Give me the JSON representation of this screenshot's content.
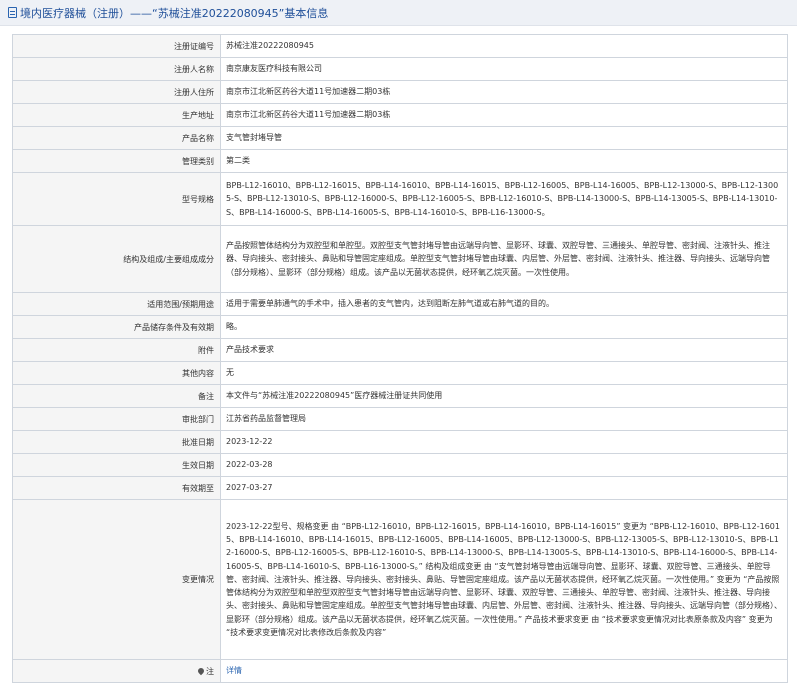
{
  "header": {
    "title": "境内医疗器械（注册）——“苏械注准20222080945”基本信息"
  },
  "rows": [
    {
      "label": "注册证编号",
      "value": "苏械注准20222080945"
    },
    {
      "label": "注册人名称",
      "value": "南京康友医疗科技有限公司"
    },
    {
      "label": "注册人住所",
      "value": "南京市江北新区药谷大道11号加速器二期03栋"
    },
    {
      "label": "生产地址",
      "value": "南京市江北新区药谷大道11号加速器二期03栋"
    },
    {
      "label": "产品名称",
      "value": "支气管封堵导管"
    },
    {
      "label": "管理类别",
      "value": "第二类"
    },
    {
      "label": "型号规格",
      "value": "BPB-L12-16010、BPB-L12-16015、BPB-L14-16010、BPB-L14-16015、BPB-L12-16005、BPB-L14-16005、BPB-L12-13000-S、BPB-L12-13005-S、BPB-L12-13010-S、BPB-L12-16000-S、BPB-L12-16005-S、BPB-L12-16010-S、BPB-L14-13000-S、BPB-L14-13005-S、BPB-L14-13010-S、BPB-L14-16000-S、BPB-L14-16005-S、BPB-L14-16010-S、BPB-L16-13000-S。"
    },
    {
      "label": "结构及组成/主要组成成分",
      "value": "产品按照管体结构分为双腔型和单腔型。双腔型支气管封堵导管由远端导向管、显影环、球囊、双腔导管、三通接头、单腔导管、密封阀、注液针头、推注器、导向接头、密封接头、鼻贴和导管固定座组成。单腔型支气管封堵导管由球囊、内层管、外层管、密封阀、注液针头、推注器、导向接头、远端导向管（部分规格）、显影环（部分规格）组成。该产品以无菌状态提供，经环氧乙烷灭菌。一次性使用。"
    },
    {
      "label": "适用范围/预期用途",
      "value": "适用于需要单肺通气的手术中，插入患者的支气管内，达到阻断左肺气道或右肺气道的目的。"
    },
    {
      "label": "产品储存条件及有效期",
      "value": "略。"
    },
    {
      "label": "附件",
      "value": "产品技术要求"
    },
    {
      "label": "其他内容",
      "value": "无"
    },
    {
      "label": "备注",
      "value": "本文件与“苏械注准20222080945”医疗器械注册证共同使用"
    },
    {
      "label": "审批部门",
      "value": "江苏省药品监督管理局"
    },
    {
      "label": "批准日期",
      "value": "2023-12-22"
    },
    {
      "label": "生效日期",
      "value": "2022-03-28"
    },
    {
      "label": "有效期至",
      "value": "2027-03-27"
    },
    {
      "label": "变更情况",
      "value": "2023-12-22型号、规格变更 由 “BPB-L12-16010，BPB-L12-16015，BPB-L14-16010，BPB-L14-16015” 变更为 “BPB-L12-16010、BPB-L12-16015、BPB-L14-16010、BPB-L14-16015、BPB-L12-16005、BPB-L14-16005、BPB-L12-13000-S、BPB-L12-13005-S、BPB-L12-13010-S、BPB-L12-16000-S、BPB-L12-16005-S、BPB-L12-16010-S、BPB-L14-13000-S、BPB-L14-13005-S、BPB-L14-13010-S、BPB-L14-16000-S、BPB-L14-16005-S、BPB-L14-16010-S、BPB-L16-13000-S。” 结构及组成变更 由 “支气管封堵导管由远端导向管、显影环、球囊、双腔导管、三通接头、单腔导管、密封阀、注液针头、推注器、导向接头、密封接头、鼻贴、导管固定座组成。该产品以无菌状态提供，经环氧乙烷灭菌。一次性使用。” 变更为 “产品按照管体结构分为双腔型和单腔型双腔型支气管封堵导管由远端导向管、显影环、球囊、双腔导管、三通接头、单腔导管、密封阀、注液针头、推注器、导向接头、密封接头、鼻贴和导管固定座组成。单腔型支气管封堵导管由球囊、内层管、外层管、密封阀、注液针头、推注器、导向接头、远端导向管（部分规格）、显影环（部分规格）组成。该产品以无菌状态提供，经环氧乙烷灭菌。一次性使用。” 产品技术要求变更 由 “技术要求变更情况对比表原条款及内容” 变更为 “技术要求变更情况对比表修改后条款及内容”"
    }
  ],
  "footer": {
    "label": "注",
    "link": "详情"
  }
}
